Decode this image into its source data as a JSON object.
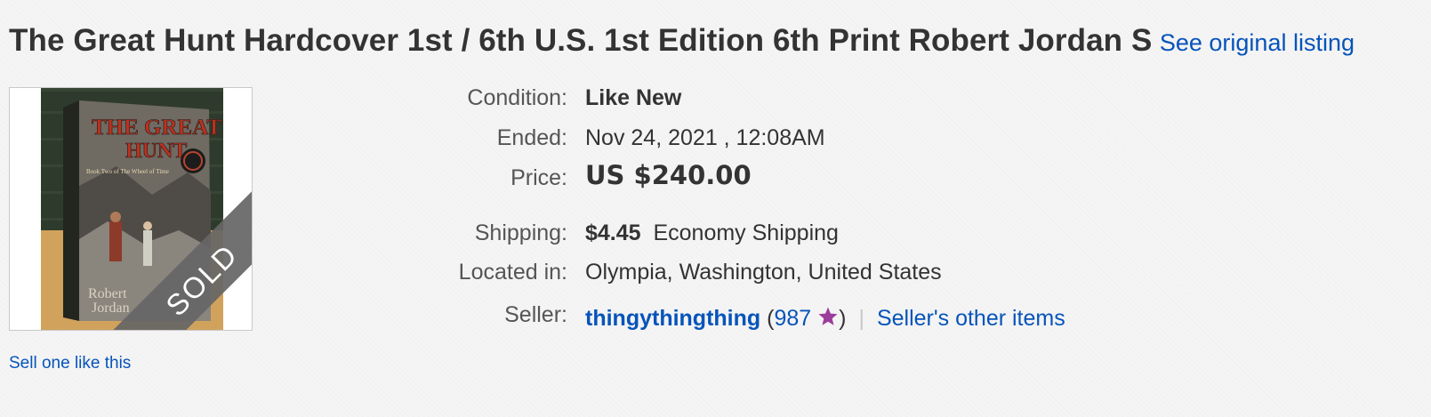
{
  "listing": {
    "title": "The Great Hunt Hardcover 1st / 6th U.S. 1st Edition 6th Print Robert Jordan S",
    "see_original_label": "See original listing"
  },
  "image": {
    "book_title_line1": "THE GREAT",
    "book_title_line2": "HUNT",
    "book_subtitle": "Book Two of The Wheel of Time",
    "book_author_line1": "Robert",
    "book_author_line2": "Jordan",
    "sold_ribbon": "SOLD"
  },
  "sell_one_label": "Sell one like this",
  "details": {
    "condition_label": "Condition:",
    "condition_value": "Like New",
    "ended_label": "Ended:",
    "ended_value": "Nov 24, 2021 , 12:08AM",
    "price_label": "Price:",
    "price_value": "US $240.00",
    "shipping_label": "Shipping:",
    "shipping_cost": "$4.45",
    "shipping_method": "Economy Shipping",
    "located_label": "Located in:",
    "located_value": "Olympia, Washington, United States",
    "seller_label": "Seller:",
    "seller_name": "thingythingthing",
    "seller_feedback_open": "(",
    "seller_feedback_count": "987",
    "seller_feedback_close": ")",
    "separator": "|",
    "seller_other_items": "Seller's other items"
  },
  "colors": {
    "link": "#0654ba",
    "text": "#333333",
    "label": "#555555",
    "star": "#9b3d9b"
  },
  "icons": {
    "feedback_star": "purple-star-icon"
  }
}
